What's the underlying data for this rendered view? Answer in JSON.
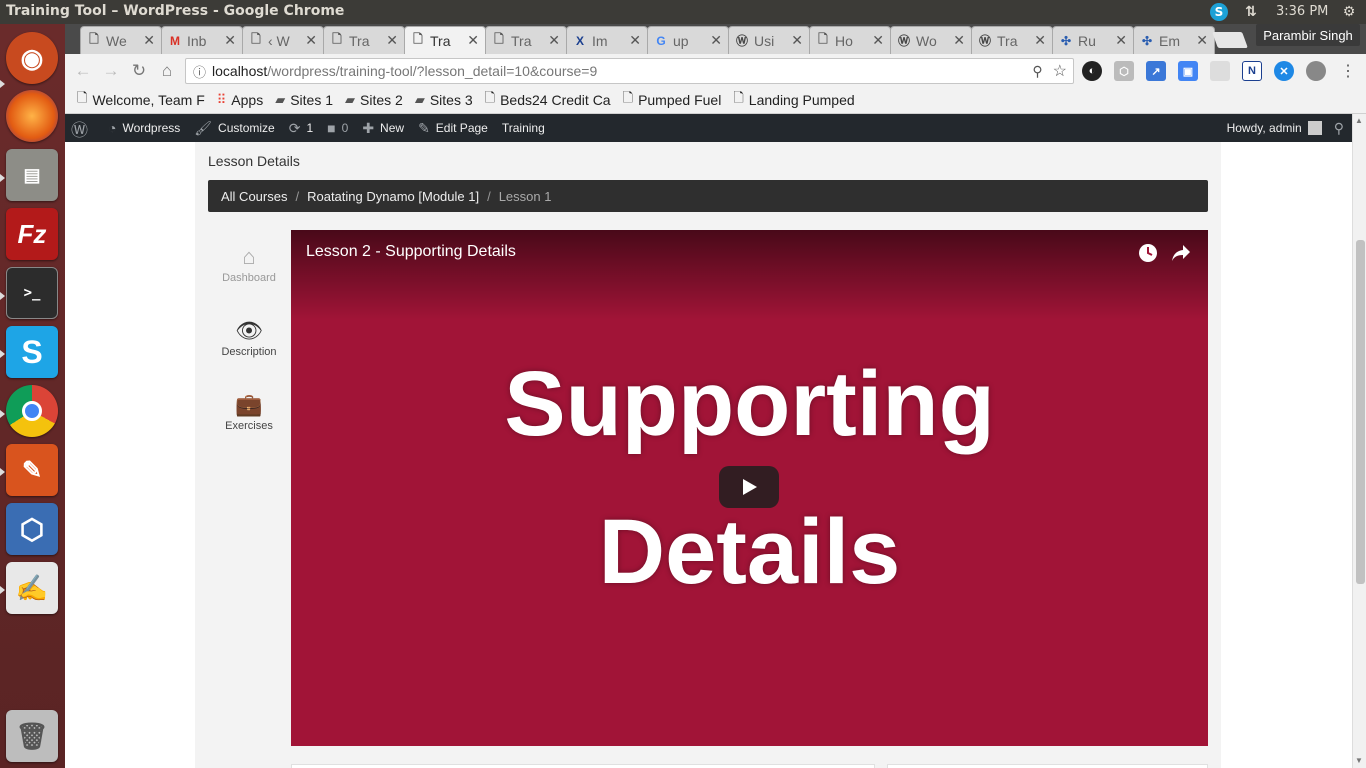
{
  "os": {
    "window_title": "Training Tool – WordPress - Google Chrome",
    "clock": "3:36 PM"
  },
  "browser": {
    "tabs": [
      {
        "title": "We",
        "icon": "page-icon"
      },
      {
        "title": "Inb",
        "icon": "gmail-icon"
      },
      {
        "title": "‹ W",
        "icon": "page-icon"
      },
      {
        "title": "Tra",
        "icon": "page-icon"
      },
      {
        "title": "Tra",
        "icon": "page-icon",
        "active": true
      },
      {
        "title": "Tra",
        "icon": "page-icon"
      },
      {
        "title": "Im",
        "icon": "x-logo-icon"
      },
      {
        "title": "up",
        "icon": "google-icon"
      },
      {
        "title": "Usi",
        "icon": "wordpress-icon"
      },
      {
        "title": "Ho",
        "icon": "page-icon"
      },
      {
        "title": "Wo",
        "icon": "wordpress-icon"
      },
      {
        "title": "Tra",
        "icon": "wordpress-icon"
      },
      {
        "title": "Ru",
        "icon": "puzzle-icon"
      },
      {
        "title": "Em",
        "icon": "puzzle-icon"
      }
    ],
    "profile_name": "Parambir Singh",
    "url_host": "localhost",
    "url_path": "/wordpress/training-tool/?lesson_detail=10&course=9",
    "bookmarks": [
      {
        "label": "Welcome, Team F",
        "icon": "page-icon"
      },
      {
        "label": "Apps",
        "icon": "apps-grid-icon"
      },
      {
        "label": "Sites 1",
        "icon": "folder-icon"
      },
      {
        "label": "Sites 2",
        "icon": "folder-icon"
      },
      {
        "label": "Sites 3",
        "icon": "folder-icon"
      },
      {
        "label": "Beds24 Credit Ca",
        "icon": "page-icon"
      },
      {
        "label": "Pumped Fuel",
        "icon": "page-icon"
      },
      {
        "label": "Landing Pumped",
        "icon": "page-icon"
      }
    ]
  },
  "wp_admin_bar": {
    "site_name": "Wordpress",
    "customize": "Customize",
    "updates_count": "1",
    "comments_count": "0",
    "new_label": "New",
    "edit_page": "Edit Page",
    "training": "Training",
    "greeting": "Howdy, admin"
  },
  "page": {
    "heading": "Lesson Details",
    "breadcrumb": [
      "All Courses",
      "Roatating Dynamo [Module 1]",
      "Lesson 1"
    ],
    "sidebar": [
      {
        "label": "Dashboard",
        "icon": "home-icon"
      },
      {
        "label": "Description",
        "icon": "eye-icon"
      },
      {
        "label": "Exercises",
        "icon": "briefcase-icon"
      }
    ],
    "video": {
      "title": "Lesson 2 - Supporting Details",
      "big_text_line1": "Supporting",
      "big_text_line2": "Details",
      "background": "#a11437"
    }
  }
}
